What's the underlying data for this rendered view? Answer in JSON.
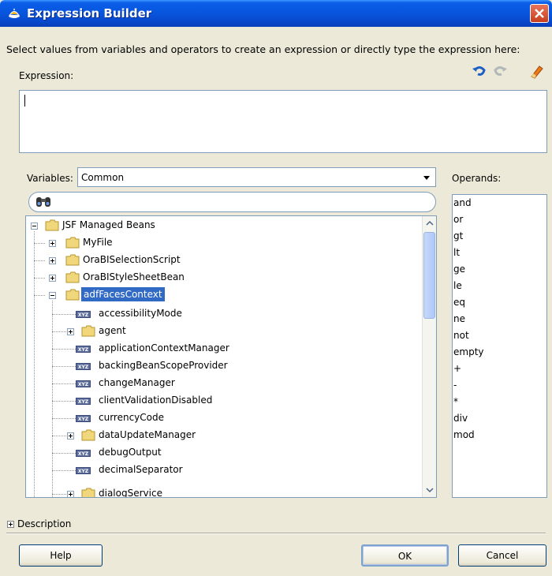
{
  "window": {
    "title": "Expression Builder"
  },
  "instruction": "Select values from variables and operators to create an expression or directly type the expression here:",
  "expression": {
    "label": "Expression:",
    "value": ""
  },
  "toolbar": {
    "undo_icon": "undo-icon",
    "redo_icon": "redo-icon",
    "clear_icon": "eraser-icon"
  },
  "variables": {
    "label": "Variables:",
    "selected": "Common",
    "search_placeholder": ""
  },
  "tree": {
    "root": "JSF Managed Beans",
    "items": [
      {
        "label": "MyFile",
        "kind": "folder"
      },
      {
        "label": "OraBISelectionScript",
        "kind": "folder"
      },
      {
        "label": "OraBIStyleSheetBean",
        "kind": "folder"
      },
      {
        "label": "adfFacesContext",
        "kind": "folder",
        "selected": true
      },
      {
        "label": "accessibilityMode",
        "kind": "property"
      },
      {
        "label": "agent",
        "kind": "folder"
      },
      {
        "label": "applicationContextManager",
        "kind": "property"
      },
      {
        "label": "backingBeanScopeProvider",
        "kind": "property"
      },
      {
        "label": "changeManager",
        "kind": "property"
      },
      {
        "label": "clientValidationDisabled",
        "kind": "property"
      },
      {
        "label": "currencyCode",
        "kind": "property"
      },
      {
        "label": "dataUpdateManager",
        "kind": "folder"
      },
      {
        "label": "debugOutput",
        "kind": "property"
      },
      {
        "label": "decimalSeparator",
        "kind": "property"
      },
      {
        "label": "dialogService",
        "kind": "folder"
      }
    ],
    "property_badge": "XYZ"
  },
  "operands": {
    "label": "Operands:",
    "items": [
      "and",
      "or",
      "gt",
      "lt",
      "ge",
      "le",
      "eq",
      "ne",
      "not",
      "empty",
      "+",
      "-",
      "*",
      "div",
      "mod"
    ]
  },
  "description": {
    "label": "Description"
  },
  "buttons": {
    "help": "Help",
    "ok": "OK",
    "cancel": "Cancel"
  },
  "colors": {
    "titlebar": "#0855dd",
    "selection": "#316ac5",
    "dialog_bg": "#ece9d8"
  }
}
